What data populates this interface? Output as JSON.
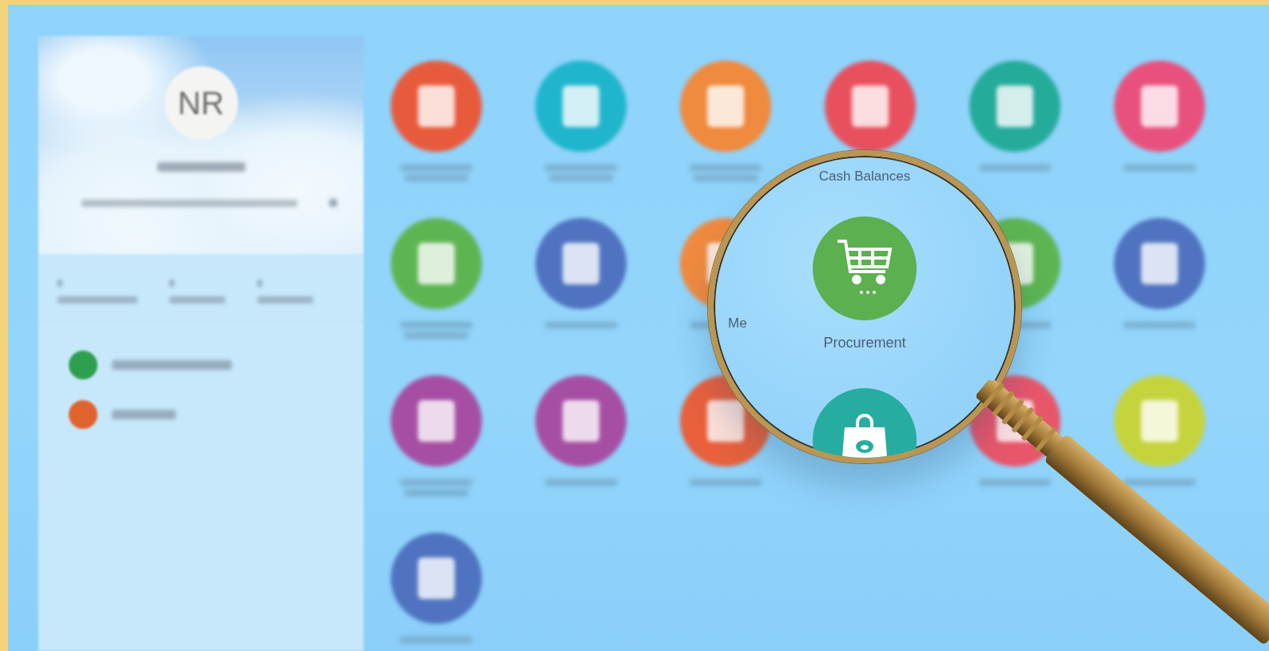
{
  "profile": {
    "initials": "NR"
  },
  "sidebar": {
    "items": [
      {
        "color": "#2e9e4f"
      },
      {
        "color": "#e0622c"
      }
    ]
  },
  "tiles": [
    {
      "color": "#e85a3c"
    },
    {
      "color": "#1fb5cc"
    },
    {
      "color": "#ef8a3f"
    },
    {
      "color": "#e8505e"
    },
    {
      "color": "#24ab9a"
    },
    {
      "color": "#e8517e"
    },
    {
      "color": "#5db552"
    },
    {
      "color": "#4f73c0"
    },
    {
      "color": "#ef8a3f"
    },
    {
      "color": "#5db552"
    },
    {
      "color": "#4f73c0"
    },
    {
      "color": "#a64ea3"
    },
    {
      "color": "#a64ea3"
    },
    {
      "color": "#e8603c"
    },
    {
      "color": "#e8566a"
    },
    {
      "color": "#c5d43d"
    },
    {
      "color": "#4f73c0"
    }
  ],
  "magnifier": {
    "top_label": "Cash Balances",
    "side_label": "Me",
    "tile": {
      "label": "Procurement",
      "color": "#5cb04f"
    },
    "next_tile": {
      "color": "#27ad9f"
    }
  }
}
